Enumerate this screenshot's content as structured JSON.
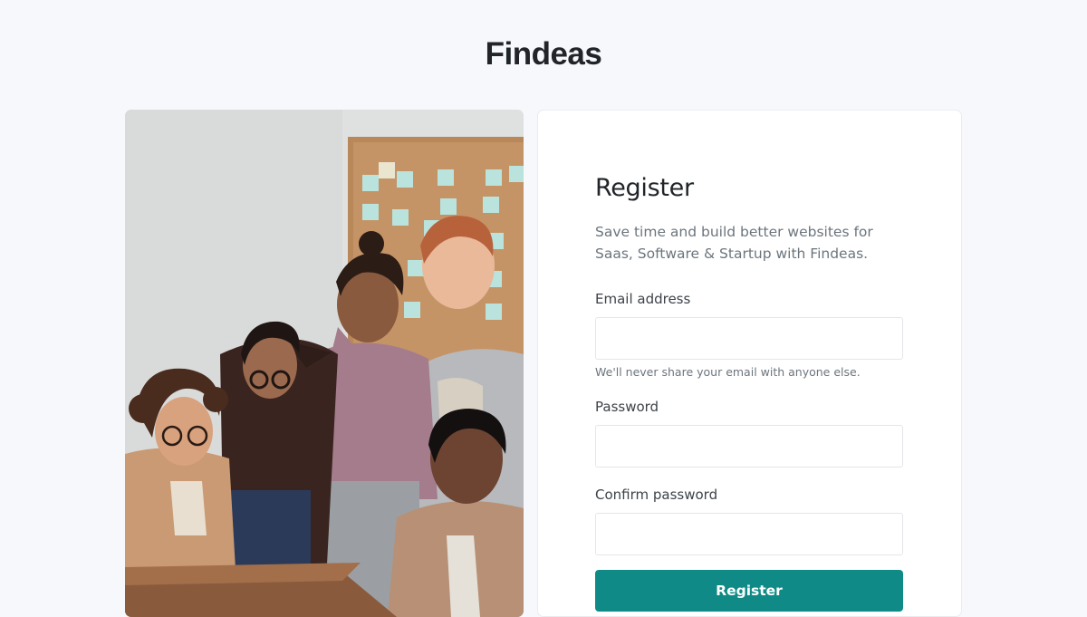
{
  "brand": {
    "name": "Findeas"
  },
  "hero_image": {
    "alt": "group of five colleagues looking at a laptop in an office",
    "semantic": "team-photo"
  },
  "form": {
    "title": "Register",
    "subtitle": "Save time and build better websites for Saas, Software & Startup with Findeas.",
    "email": {
      "label": "Email address",
      "value": "",
      "placeholder": "",
      "help": "We'll never share your email with anyone else."
    },
    "password": {
      "label": "Password",
      "value": "",
      "placeholder": ""
    },
    "confirm_password": {
      "label": "Confirm password",
      "value": "",
      "placeholder": ""
    },
    "submit_label": "Register"
  },
  "colors": {
    "page_background": "#f7f8fb",
    "card_background": "#ffffff",
    "accent": "#0f8a86",
    "text_primary": "#212529",
    "text_muted": "#6c757d"
  }
}
